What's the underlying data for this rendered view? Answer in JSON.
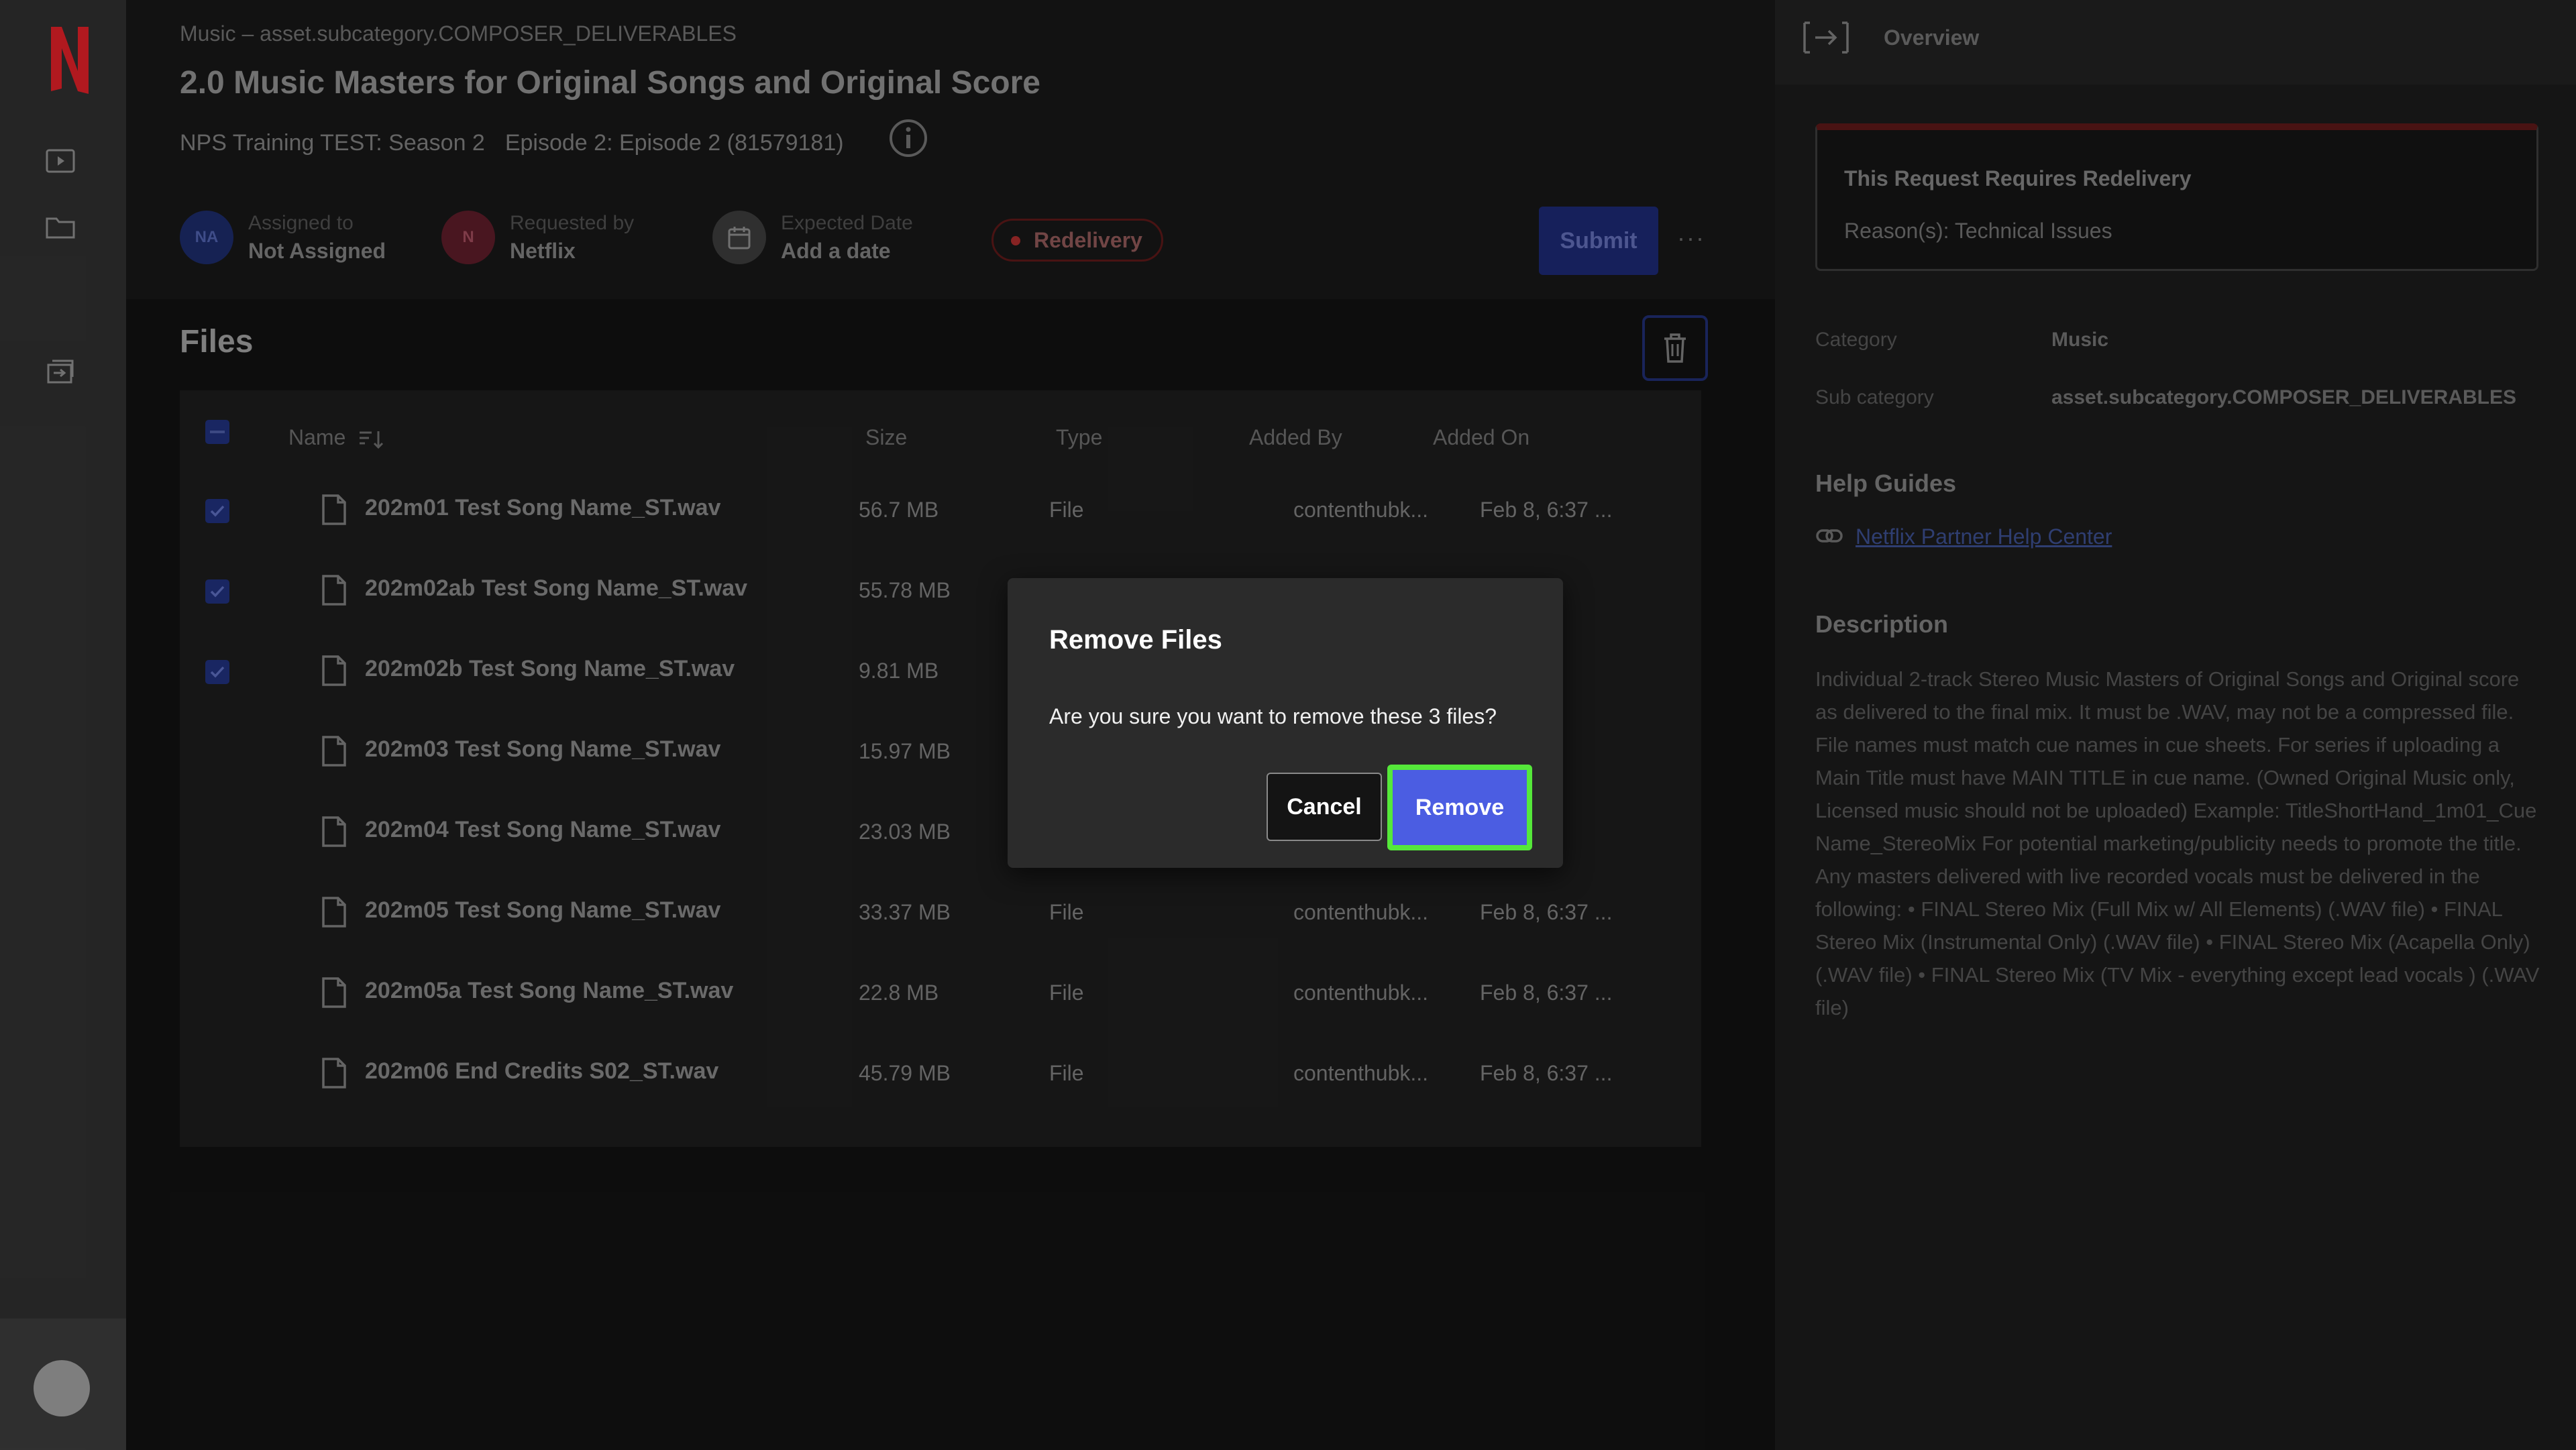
{
  "nav": {
    "logo_letter": "N",
    "items": [
      "play-icon",
      "folder-icon",
      "tasks-icon"
    ]
  },
  "main": {
    "breadcrumb": "Music – asset.subcategory.COMPOSER_DELIVERABLES",
    "title": "2.0 Music Masters for Original Songs and Original Score",
    "show": "NPS Training TEST: Season 2",
    "episode": "Episode 2: Episode 2 (81579181)",
    "assigned": {
      "initials": "NA",
      "label": "Assigned to",
      "value": "Not Assigned"
    },
    "requested": {
      "initials": "N",
      "label": "Requested by",
      "value": "Netflix"
    },
    "expected": {
      "label": "Expected Date",
      "value": "Add a date"
    },
    "status": "Redelivery",
    "submit_label": "Submit",
    "more_label": "···"
  },
  "files": {
    "title": "Files",
    "columns": {
      "name": "Name",
      "size": "Size",
      "type": "Type",
      "added_by": "Added By",
      "added_on": "Added On"
    },
    "rows": [
      {
        "name": "202m01 Test Song Name_ST.wav",
        "size": "56.7 MB",
        "type": "File",
        "added_by": "contenthubk...",
        "added_on": "Feb 8, 6:37 ...",
        "checked": true
      },
      {
        "name": "202m02ab Test Song Name_ST.wav",
        "size": "55.78 MB",
        "type": "",
        "added_by": "",
        "added_on": "",
        "checked": true
      },
      {
        "name": "202m02b Test Song Name_ST.wav",
        "size": "9.81 MB",
        "type": "",
        "added_by": "",
        "added_on": "",
        "checked": true
      },
      {
        "name": "202m03 Test Song Name_ST.wav",
        "size": "15.97 MB",
        "type": "",
        "added_by": "",
        "added_on": "",
        "checked": false
      },
      {
        "name": "202m04 Test Song Name_ST.wav",
        "size": "23.03 MB",
        "type": "",
        "added_by": "",
        "added_on": "",
        "checked": false
      },
      {
        "name": "202m05 Test Song Name_ST.wav",
        "size": "33.37 MB",
        "type": "File",
        "added_by": "contenthubk...",
        "added_on": "Feb 8, 6:37 ...",
        "checked": false
      },
      {
        "name": "202m05a Test Song Name_ST.wav",
        "size": "22.8 MB",
        "type": "File",
        "added_by": "contenthubk...",
        "added_on": "Feb 8, 6:37 ...",
        "checked": false
      },
      {
        "name": "202m06 End Credits S02_ST.wav",
        "size": "45.79 MB",
        "type": "File",
        "added_by": "contenthubk...",
        "added_on": "Feb 8, 6:37 ...",
        "checked": false
      }
    ]
  },
  "panel": {
    "title": "Overview",
    "alert_title": "This Request Requires Redelivery",
    "alert_reason": "Reason(s): Technical Issues",
    "category_label": "Category",
    "category_value": "Music",
    "subcategory_label": "Sub category",
    "subcategory_value": "asset.subcategory.COMPOSER_DELIVERABLES",
    "help_title": "Help Guides",
    "help_link": "Netflix Partner Help Center",
    "description_title": "Description",
    "description": "Individual 2-track Stereo Music Masters of Original Songs and Original score as delivered to the final mix. It must be .WAV, may not be a compressed file. File names must match cue names in cue sheets. For series if uploading a Main Title must have MAIN TITLE in cue name. (Owned Original Music only, Licensed music should not be uploaded) Example: TitleShortHand_1m01_Cue Name_StereoMix For potential marketing/publicity needs to promote the title. Any masters delivered with live recorded vocals must be delivered in the following: • FINAL Stereo Mix (Full Mix w/ All Elements) (.WAV file) • FINAL Stereo Mix (Instrumental Only) (.WAV file) • FINAL Stereo Mix (Acapella Only) (.WAV file) • FINAL Stereo Mix (TV Mix - everything except lead vocals ) (.WAV file)"
  },
  "modal": {
    "title": "Remove Files",
    "message": "Are you sure you want to remove these 3 files?",
    "cancel_label": "Cancel",
    "remove_label": "Remove"
  },
  "colors": {
    "accent": "#4b5de2",
    "focus_ring": "#55e83a",
    "brand": "#e50914",
    "alert": "#a52b2b"
  }
}
